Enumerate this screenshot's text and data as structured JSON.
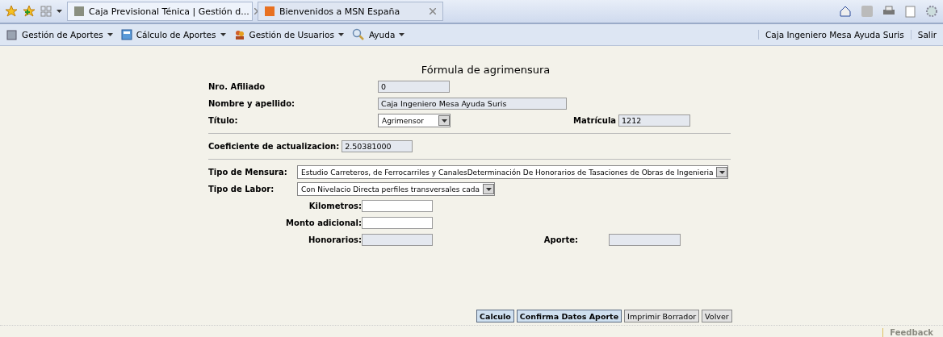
{
  "browser_tabs": [
    {
      "label": "Caja Previsional Ténica | Gestión d...",
      "selected": true
    },
    {
      "label": "Bienvenidos a MSN España",
      "selected": false
    }
  ],
  "menu": [
    {
      "label": "Gestión de Aportes",
      "kind": "folder"
    },
    {
      "label": "Cálculo de Aportes",
      "kind": "calc"
    },
    {
      "label": "Gestión de Usuarios",
      "kind": "users"
    },
    {
      "label": "Ayuda",
      "kind": "search"
    }
  ],
  "user": {
    "name": "Caja Ingeniero Mesa Ayuda Suris",
    "logout": "Salir"
  },
  "form": {
    "title": "Fórmula de agrimensura",
    "nro_afiliado": {
      "label": "Nro. Afiliado",
      "value": "0"
    },
    "nombre": {
      "label": "Nombre y apellido:",
      "value": "Caja Ingeniero Mesa Ayuda Suris"
    },
    "titulo": {
      "label": "Título:",
      "value": "Agrimensor"
    },
    "matricula": {
      "label": "Matrícula",
      "value": "1212"
    },
    "coeficiente": {
      "label": "Coeficiente de actualizacion:",
      "value": "2.50381000"
    },
    "tipo_mensura": {
      "label": "Tipo de Mensura:",
      "value": "Estudio Carreteros, de Ferrocarriles y CanalesDeterminación De Honorarios de Tasaciones de Obras de Ingenieria"
    },
    "tipo_labor": {
      "label": "Tipo de Labor:",
      "value": "Con Nivelacio Directa perfiles transversales cada"
    },
    "kilometros": {
      "label": "Kilometros:"
    },
    "monto": {
      "label": "Monto adicional:"
    },
    "honorarios": {
      "label": "Honorarios:"
    },
    "aporte": {
      "label": "Aporte:"
    }
  },
  "buttons": [
    {
      "label": "Calculo",
      "kind": "primary"
    },
    {
      "label": "Confirma Datos Aporte",
      "kind": "primary"
    },
    {
      "label": "Imprimir Borrador",
      "kind": "plain"
    },
    {
      "label": "Volver",
      "kind": "plain"
    }
  ],
  "footer": {
    "feedback": "Feedback"
  }
}
